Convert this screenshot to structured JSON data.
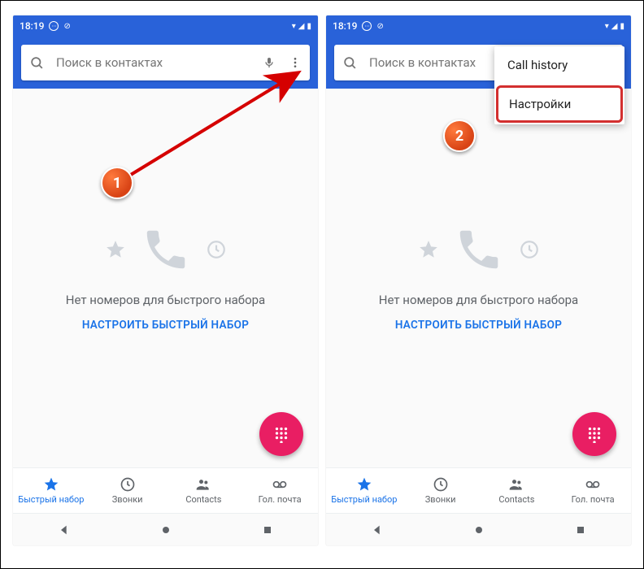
{
  "status": {
    "time": "18:19"
  },
  "search": {
    "placeholder": "Поиск в контактах"
  },
  "empty": {
    "message": "Нет номеров для быстрого набора",
    "action": "НАСТРОИТЬ БЫСТРЫЙ НАБОР"
  },
  "tabs": {
    "speed": "Быстрый набор",
    "calls": "Звонки",
    "contacts": "Contacts",
    "voicemail": "Гол. почта"
  },
  "menu": {
    "call_history": "Call history",
    "settings": "Настройки"
  },
  "annot": {
    "step1": "1",
    "step2": "2"
  }
}
